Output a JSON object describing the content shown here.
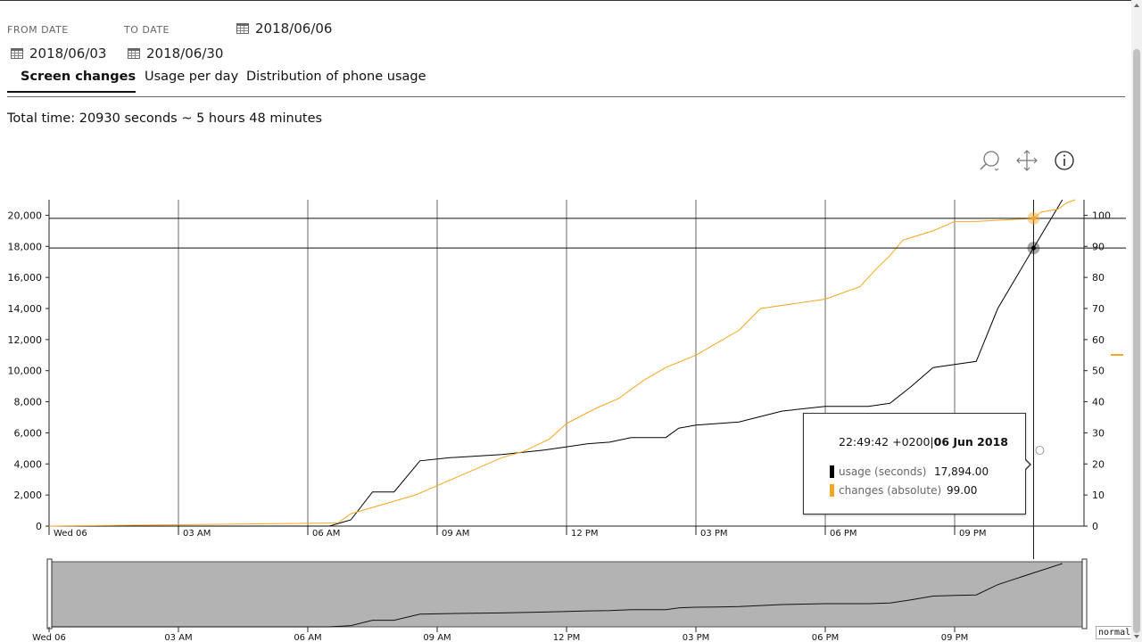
{
  "filters": {
    "from_label": "FROM DATE",
    "to_label": "TO DATE",
    "selected_date": "2018/06/06",
    "from_date": "2018/06/03",
    "to_date": "2018/06/30"
  },
  "tabs": [
    {
      "label": "Screen changes",
      "active": true
    },
    {
      "label": "Usage per day",
      "active": false
    },
    {
      "label": "Distribution of phone usage",
      "active": false
    }
  ],
  "summary": {
    "total_time": "Total time: 20930 seconds ~ 5 hours 48 minutes"
  },
  "tooltip": {
    "time": "22:49:42 +0200",
    "date": "06 Jun 2018",
    "rows": [
      {
        "label": "usage (seconds)",
        "value": "17,894.00",
        "color": "#000000"
      },
      {
        "label": "changes (absolute)",
        "value": "99.00",
        "color": "#f5a623"
      }
    ]
  },
  "mode_badge": "normal",
  "colors": {
    "usage": "#000000",
    "changes": "#f5a623",
    "navigator_fill": "#b3b3b3"
  },
  "icons": [
    "zoom-icon",
    "pan-icon",
    "info-icon",
    "calendar-icon"
  ],
  "chart_data": {
    "type": "line",
    "x_unit": "hours since 00:00 on Wed 06 Jun 2018",
    "x_ticks": [
      "Wed 06",
      "03 AM",
      "06 AM",
      "09 AM",
      "12 PM",
      "03 PM",
      "06 PM",
      "09 PM"
    ],
    "xlim": [
      0,
      24
    ],
    "y_left": {
      "ticks": [
        "0",
        "2,000",
        "4,000",
        "6,000",
        "8,000",
        "10,000",
        "12,000",
        "14,000",
        "16,000",
        "18,000",
        "20,000"
      ],
      "ylim": [
        0,
        21000
      ]
    },
    "y_right": {
      "ticks": [
        "0",
        "10",
        "20",
        "30",
        "40",
        "50",
        "60",
        "70",
        "80",
        "90",
        "100"
      ],
      "ylim": [
        0,
        105
      ]
    },
    "grid": true,
    "crosshair_x": 22.83,
    "series": [
      {
        "name": "usage (seconds)",
        "axis": "left",
        "color": "#000000",
        "points": [
          [
            0,
            0
          ],
          [
            6.5,
            0
          ],
          [
            7.0,
            400
          ],
          [
            7.5,
            2200
          ],
          [
            8.0,
            2200
          ],
          [
            8.6,
            4200
          ],
          [
            9.3,
            4400
          ],
          [
            10.5,
            4600
          ],
          [
            11.5,
            4900
          ],
          [
            12.5,
            5300
          ],
          [
            13.0,
            5400
          ],
          [
            13.5,
            5700
          ],
          [
            14.3,
            5700
          ],
          [
            14.6,
            6300
          ],
          [
            15.0,
            6500
          ],
          [
            15.5,
            6600
          ],
          [
            16.0,
            6700
          ],
          [
            17.0,
            7400
          ],
          [
            18.0,
            7700
          ],
          [
            19.0,
            7700
          ],
          [
            19.5,
            7900
          ],
          [
            20.0,
            9000
          ],
          [
            20.5,
            10200
          ],
          [
            21.0,
            10400
          ],
          [
            21.5,
            10600
          ],
          [
            22.0,
            14000
          ],
          [
            22.83,
            17894
          ],
          [
            23.5,
            21000
          ]
        ]
      },
      {
        "name": "changes (absolute)",
        "axis": "right",
        "color": "#f5a623",
        "points": [
          [
            0,
            0
          ],
          [
            6.7,
            1
          ],
          [
            7.0,
            4
          ],
          [
            7.5,
            6
          ],
          [
            8.5,
            10
          ],
          [
            9.0,
            13
          ],
          [
            9.5,
            16
          ],
          [
            10.0,
            19
          ],
          [
            10.5,
            22
          ],
          [
            11.0,
            24
          ],
          [
            11.6,
            28
          ],
          [
            12.0,
            33
          ],
          [
            12.7,
            38
          ],
          [
            13.2,
            41
          ],
          [
            13.8,
            47
          ],
          [
            14.3,
            51
          ],
          [
            15.0,
            55
          ],
          [
            15.5,
            59
          ],
          [
            16.0,
            63
          ],
          [
            16.5,
            70
          ],
          [
            17.5,
            72
          ],
          [
            18.0,
            73
          ],
          [
            18.8,
            77
          ],
          [
            19.2,
            83
          ],
          [
            19.5,
            87
          ],
          [
            19.8,
            92
          ],
          [
            20.5,
            95
          ],
          [
            21.0,
            98
          ],
          [
            21.5,
            98
          ],
          [
            22.83,
            99
          ],
          [
            23.0,
            101
          ],
          [
            23.4,
            102
          ],
          [
            23.6,
            104
          ],
          [
            23.8,
            105
          ]
        ]
      }
    ],
    "highlight": {
      "usage": 17894,
      "changes": 99
    }
  }
}
